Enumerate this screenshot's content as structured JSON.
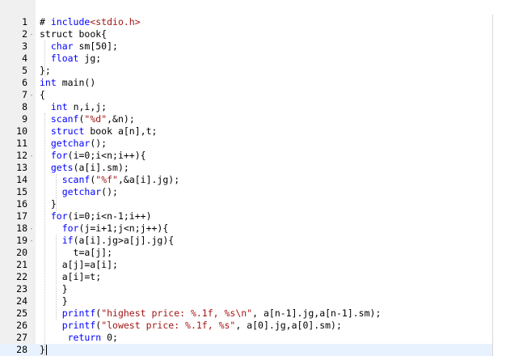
{
  "editor": {
    "lines": [
      {
        "num": "1",
        "fold": "",
        "tokens": [
          {
            "t": "# ",
            "c": ""
          },
          {
            "t": "include",
            "c": "kw"
          },
          {
            "t": "<stdio.h>",
            "c": "inc"
          }
        ]
      },
      {
        "num": "2",
        "fold": "-",
        "tokens": [
          {
            "t": "struct",
            "c": ""
          },
          {
            "t": " book{",
            "c": ""
          }
        ]
      },
      {
        "num": "3",
        "fold": "",
        "tokens": [
          {
            "t": "  ",
            "c": ""
          },
          {
            "t": "char",
            "c": "kw"
          },
          {
            "t": " sm[50];",
            "c": ""
          }
        ]
      },
      {
        "num": "4",
        "fold": "",
        "tokens": [
          {
            "t": "  ",
            "c": ""
          },
          {
            "t": "float",
            "c": "kw"
          },
          {
            "t": " jg;",
            "c": ""
          }
        ]
      },
      {
        "num": "5",
        "fold": "",
        "tokens": [
          {
            "t": "};",
            "c": ""
          }
        ]
      },
      {
        "num": "6",
        "fold": "",
        "tokens": [
          {
            "t": "int",
            "c": "kw"
          },
          {
            "t": " main()",
            "c": ""
          }
        ]
      },
      {
        "num": "7",
        "fold": "-",
        "tokens": [
          {
            "t": "{",
            "c": ""
          }
        ]
      },
      {
        "num": "8",
        "fold": "",
        "tokens": [
          {
            "t": "  ",
            "c": ""
          },
          {
            "t": "int",
            "c": "kw"
          },
          {
            "t": " n,i,j;",
            "c": ""
          }
        ]
      },
      {
        "num": "9",
        "fold": "",
        "tokens": [
          {
            "t": "  ",
            "c": ""
          },
          {
            "t": "scanf",
            "c": "fn"
          },
          {
            "t": "(",
            "c": ""
          },
          {
            "t": "\"%d\"",
            "c": "str"
          },
          {
            "t": ",&n);",
            "c": ""
          }
        ]
      },
      {
        "num": "10",
        "fold": "",
        "tokens": [
          {
            "t": "  ",
            "c": ""
          },
          {
            "t": "struct",
            "c": "kw"
          },
          {
            "t": " book a[n],t;",
            "c": ""
          }
        ]
      },
      {
        "num": "11",
        "fold": "",
        "tokens": [
          {
            "t": "  ",
            "c": ""
          },
          {
            "t": "getchar",
            "c": "fn"
          },
          {
            "t": "();",
            "c": ""
          }
        ]
      },
      {
        "num": "12",
        "fold": "-",
        "tokens": [
          {
            "t": "  ",
            "c": ""
          },
          {
            "t": "for",
            "c": "kw"
          },
          {
            "t": "(i=0;i<n;i++){",
            "c": ""
          }
        ]
      },
      {
        "num": "13",
        "fold": "",
        "tokens": [
          {
            "t": "  ",
            "c": ""
          },
          {
            "t": "gets",
            "c": "fn"
          },
          {
            "t": "(a[i].sm);",
            "c": ""
          }
        ]
      },
      {
        "num": "14",
        "fold": "",
        "tokens": [
          {
            "t": "    ",
            "c": ""
          },
          {
            "t": "scanf",
            "c": "fn"
          },
          {
            "t": "(",
            "c": ""
          },
          {
            "t": "\"%f\"",
            "c": "str"
          },
          {
            "t": ",&a[i].jg);",
            "c": ""
          }
        ]
      },
      {
        "num": "15",
        "fold": "",
        "tokens": [
          {
            "t": "    ",
            "c": ""
          },
          {
            "t": "getchar",
            "c": "fn"
          },
          {
            "t": "();",
            "c": ""
          }
        ]
      },
      {
        "num": "16",
        "fold": "",
        "tokens": [
          {
            "t": "  }",
            "c": ""
          }
        ]
      },
      {
        "num": "17",
        "fold": "",
        "tokens": [
          {
            "t": "  ",
            "c": ""
          },
          {
            "t": "for",
            "c": "kw"
          },
          {
            "t": "(i=0;i<n-1;i++)",
            "c": ""
          }
        ]
      },
      {
        "num": "18",
        "fold": "-",
        "tokens": [
          {
            "t": "    ",
            "c": ""
          },
          {
            "t": "for",
            "c": "kw"
          },
          {
            "t": "(j=i+1;j<n;j++){",
            "c": ""
          }
        ]
      },
      {
        "num": "19",
        "fold": "-",
        "tokens": [
          {
            "t": "    ",
            "c": ""
          },
          {
            "t": "if",
            "c": "kw"
          },
          {
            "t": "(a[i].jg>a[j].jg){",
            "c": ""
          }
        ]
      },
      {
        "num": "20",
        "fold": "",
        "tokens": [
          {
            "t": "      t=a[j];",
            "c": ""
          }
        ]
      },
      {
        "num": "21",
        "fold": "",
        "tokens": [
          {
            "t": "    a[j]=a[i];",
            "c": ""
          }
        ]
      },
      {
        "num": "22",
        "fold": "",
        "tokens": [
          {
            "t": "    a[i]=t;",
            "c": ""
          }
        ]
      },
      {
        "num": "23",
        "fold": "",
        "tokens": [
          {
            "t": "    }",
            "c": ""
          }
        ]
      },
      {
        "num": "24",
        "fold": "",
        "tokens": [
          {
            "t": "    }",
            "c": ""
          }
        ]
      },
      {
        "num": "25",
        "fold": "",
        "tokens": [
          {
            "t": "    ",
            "c": ""
          },
          {
            "t": "printf",
            "c": "fn"
          },
          {
            "t": "(",
            "c": ""
          },
          {
            "t": "\"highest price: %.1f, %s\\n\"",
            "c": "str"
          },
          {
            "t": ", a[n-1].jg,a[n-1].sm);",
            "c": ""
          }
        ]
      },
      {
        "num": "26",
        "fold": "",
        "tokens": [
          {
            "t": "    ",
            "c": ""
          },
          {
            "t": "printf",
            "c": "fn"
          },
          {
            "t": "(",
            "c": ""
          },
          {
            "t": "\"lowest price: %.1f, %s\"",
            "c": "str"
          },
          {
            "t": ", a[0].jg,a[0].sm);",
            "c": ""
          }
        ]
      },
      {
        "num": "27",
        "fold": "",
        "tokens": [
          {
            "t": "     ",
            "c": ""
          },
          {
            "t": "return",
            "c": "kw"
          },
          {
            "t": " 0;",
            "c": ""
          }
        ]
      },
      {
        "num": "28",
        "fold": "",
        "tokens": [
          {
            "t": "}",
            "c": ""
          }
        ]
      }
    ]
  },
  "colors": {
    "keyword": "#0000ff",
    "string": "#a31515",
    "gutter_bg": "#f0f0f0",
    "active_line_bg": "#e8f2ff"
  }
}
